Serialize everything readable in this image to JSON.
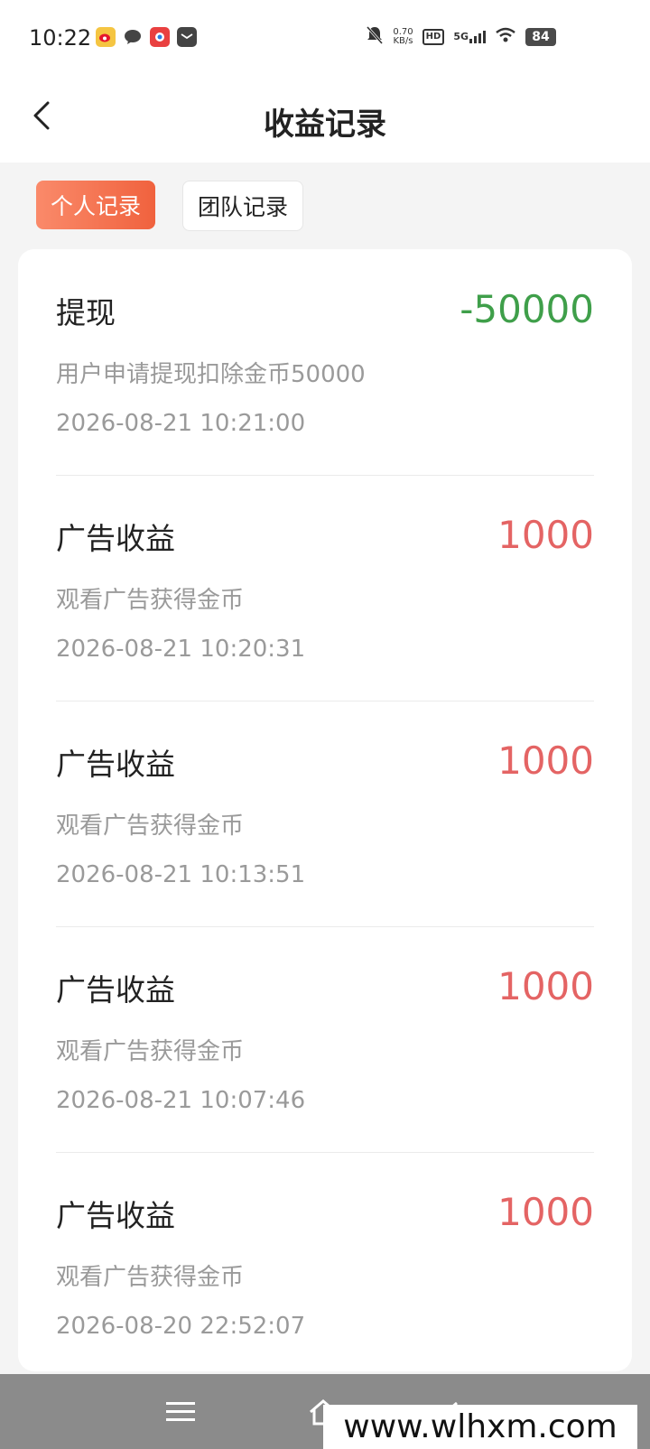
{
  "status_bar": {
    "time": "10:22",
    "net_speed_value": "0.70",
    "net_speed_unit": "KB/s",
    "hd_label": "HD",
    "network": "5G",
    "battery": "84"
  },
  "header": {
    "title": "收益记录"
  },
  "tabs": [
    {
      "label": "个人记录",
      "active": true
    },
    {
      "label": "团队记录",
      "active": false
    }
  ],
  "records": [
    {
      "title": "提现",
      "amount": "-50000",
      "desc": "用户申请提现扣除金币50000",
      "time": "2026-08-21 10:21:00",
      "amount_color": "#3f9f4a"
    },
    {
      "title": "广告收益",
      "amount": "1000",
      "desc": "观看广告获得金币",
      "time": "2026-08-21 10:20:31",
      "amount_color": "#e46464"
    },
    {
      "title": "广告收益",
      "amount": "1000",
      "desc": "观看广告获得金币",
      "time": "2026-08-21 10:13:51",
      "amount_color": "#e46464"
    },
    {
      "title": "广告收益",
      "amount": "1000",
      "desc": "观看广告获得金币",
      "time": "2026-08-21 10:07:46",
      "amount_color": "#e46464"
    },
    {
      "title": "广告收益",
      "amount": "1000",
      "desc": "观看广告获得金币",
      "time": "2026-08-20 22:52:07",
      "amount_color": "#e46464"
    }
  ],
  "watermark": "www.wlhxm.com",
  "colors": {
    "accent": "#f0623e",
    "negative_amount": "#3f9f4a",
    "positive_amount": "#e46464"
  }
}
